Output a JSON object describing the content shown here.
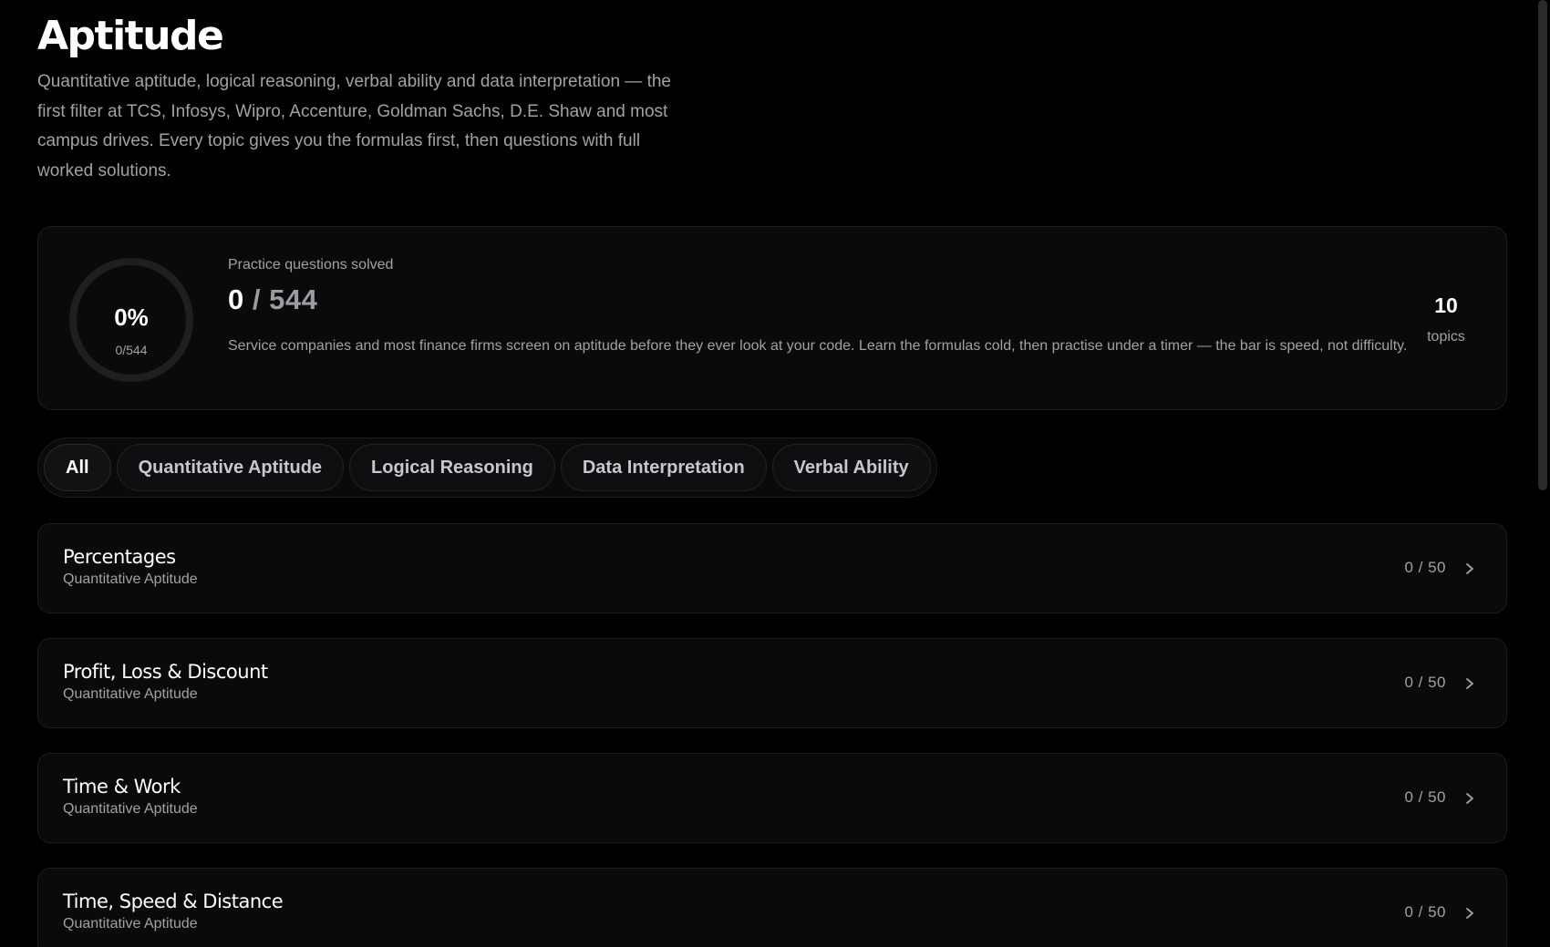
{
  "header": {
    "title": "Aptitude",
    "description": "Quantitative aptitude, logical reasoning, verbal ability and data interpretation — the first filter at TCS, Infosys, Wipro, Accenture, Goldman Sachs, D.E. Shaw and most campus drives. Every topic gives you the formulas first, then questions with full worked solutions."
  },
  "progress": {
    "percent_label": "0%",
    "fraction_label": "0/544",
    "percent_value": 0,
    "stats_label": "Practice questions solved",
    "solved": "0",
    "separator": "/",
    "total": "544",
    "note": "Service companies and most finance firms screen on aptitude before they ever look at your code. Learn the formulas cold, then practise under a timer — the bar is speed, not difficulty.",
    "topics_count": "10",
    "topics_label": "topics"
  },
  "tabs": [
    {
      "label": "All",
      "active": true
    },
    {
      "label": "Quantitative Aptitude",
      "active": false
    },
    {
      "label": "Logical Reasoning",
      "active": false
    },
    {
      "label": "Data Interpretation",
      "active": false
    },
    {
      "label": "Verbal Ability",
      "active": false
    }
  ],
  "topics": [
    {
      "name": "Percentages",
      "category": "Quantitative Aptitude",
      "progress": "0 / 50"
    },
    {
      "name": "Profit, Loss & Discount",
      "category": "Quantitative Aptitude",
      "progress": "0 / 50"
    },
    {
      "name": "Time & Work",
      "category": "Quantitative Aptitude",
      "progress": "0 / 50"
    },
    {
      "name": "Time, Speed & Distance",
      "category": "Quantitative Aptitude",
      "progress": "0 / 50"
    }
  ],
  "colors": {
    "background": "#000000",
    "card": "#0a0a0b",
    "border": "#1c1c1f",
    "muted_text": "#a1a1a6",
    "ring_track": "#1f1f22"
  },
  "icons": {
    "row_chevron": "chevron-right-icon"
  }
}
